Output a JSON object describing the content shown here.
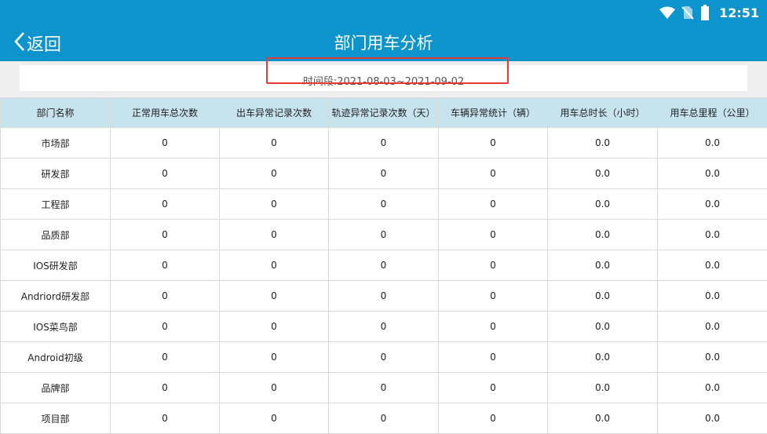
{
  "status_bar": {
    "time": "12:51",
    "icons": [
      "wifi-icon",
      "no-sim-icon",
      "battery-icon"
    ]
  },
  "header": {
    "back_label": "返回",
    "title": "部门用车分析"
  },
  "date_range": {
    "text": "时间段:2021-08-03~2021-09-02"
  },
  "table": {
    "columns": [
      "部门名称",
      "正常用车总次数",
      "出车异常记录次数",
      "轨迹异常记录次数（天）",
      "车辆异常统计（辆）",
      "用车总时长（小时）",
      "用车总里程（公里）"
    ],
    "rows": [
      [
        "市场部",
        "0",
        "0",
        "0",
        "0",
        "0.0",
        "0.0"
      ],
      [
        "研发部",
        "0",
        "0",
        "0",
        "0",
        "0.0",
        "0.0"
      ],
      [
        "工程部",
        "0",
        "0",
        "0",
        "0",
        "0.0",
        "0.0"
      ],
      [
        "品质部",
        "0",
        "0",
        "0",
        "0",
        "0.0",
        "0.0"
      ],
      [
        "IOS研发部",
        "0",
        "0",
        "0",
        "0",
        "0.0",
        "0.0"
      ],
      [
        "Andriord研发部",
        "0",
        "0",
        "0",
        "0",
        "0.0",
        "0.0"
      ],
      [
        "IOS菜鸟部",
        "0",
        "0",
        "0",
        "0",
        "0.0",
        "0.0"
      ],
      [
        "Android初级",
        "0",
        "0",
        "0",
        "0",
        "0.0",
        "0.0"
      ],
      [
        "品牌部",
        "0",
        "0",
        "0",
        "0",
        "0.0",
        "0.0"
      ],
      [
        "项目部",
        "0",
        "0",
        "0",
        "0",
        "0.0",
        "0.0"
      ]
    ]
  },
  "colors": {
    "app_bar": "#0d94cc",
    "header_row": "#c7e3ee",
    "highlight_border": "#e53935"
  }
}
